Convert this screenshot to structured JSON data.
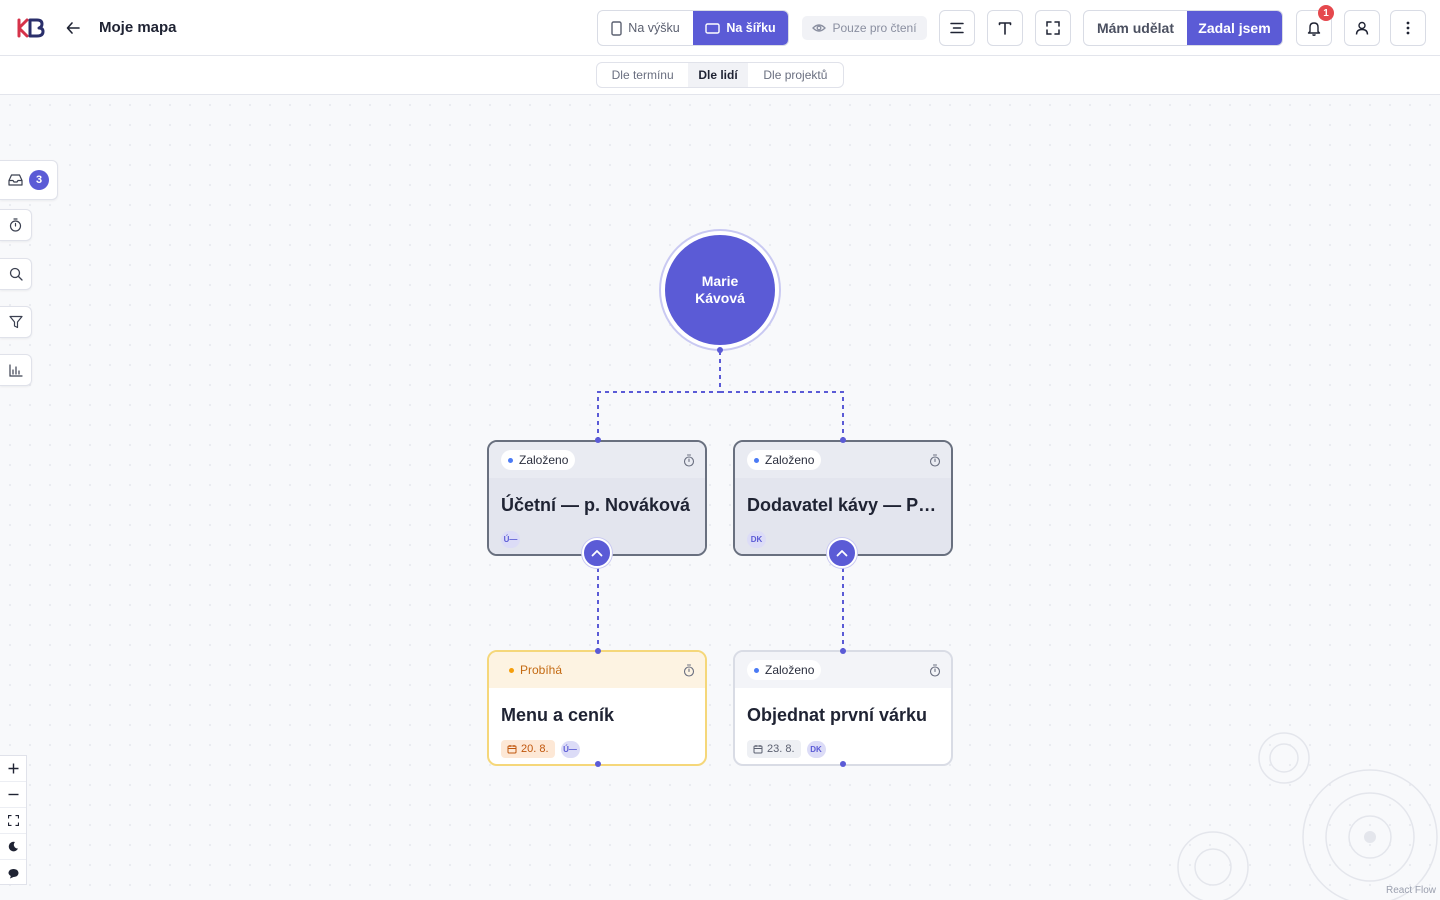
{
  "header": {
    "logo_text": "KB",
    "title": "Moje mapa",
    "orientation": {
      "portrait": "Na výšku",
      "landscape": "Na šířku",
      "active": "landscape"
    },
    "readonly_label": "Pouze pro čtení",
    "task_filter": {
      "mine": "Mám udělat",
      "assigned": "Zadal jsem",
      "active": "assigned"
    },
    "notifications_count": "1"
  },
  "grouping": {
    "options": [
      "Dle termínu",
      "Dle lidí",
      "Dle projektů"
    ],
    "active": "Dle lidí"
  },
  "sidebar": {
    "inbox_count": "3"
  },
  "root": {
    "name": "Marie Kávová"
  },
  "nodes": [
    {
      "status": "Založeno",
      "title": "Účetní — p. Nováková",
      "avatar": "Ú—",
      "date": ""
    },
    {
      "status": "Založeno",
      "title": "Dodavatel kávy — Praž",
      "avatar": "DK",
      "date": ""
    },
    {
      "status": "Probíhá",
      "title": "Menu a ceník",
      "avatar": "Ú—",
      "date": "20. 8."
    },
    {
      "status": "Založeno",
      "title": "Objednat první várku",
      "avatar": "DK",
      "date": "23. 8."
    }
  ],
  "colors": {
    "accent": "#5b5bd6",
    "running_border": "#f5d77a",
    "date_bg": "#fde8d6",
    "badge_red": "#e5484d"
  },
  "attribution": "React Flow"
}
